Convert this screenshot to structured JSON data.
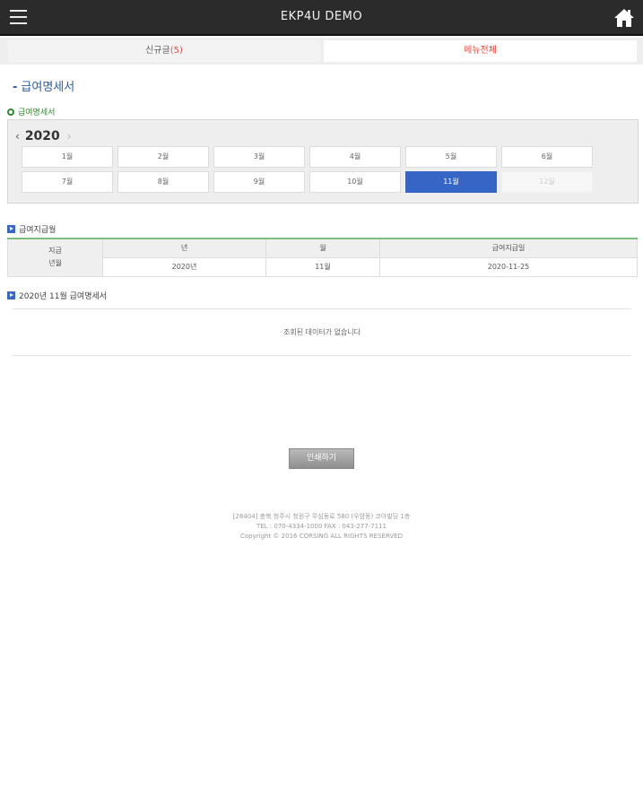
{
  "header": {
    "title": "EKP4U DEMO",
    "menu_icon": "hamburger-icon",
    "home_icon": "home-icon"
  },
  "tabs": {
    "new_label": "신규글",
    "new_count": "(5)",
    "menu_label": "메뉴전체"
  },
  "page": {
    "title": "급여명세서",
    "subtitle": "급여명세서"
  },
  "calendar": {
    "year": "2020",
    "prev": "‹",
    "next": "›",
    "months": [
      "1월",
      "2월",
      "3월",
      "4월",
      "5월",
      "6월",
      "7월",
      "8월",
      "9월",
      "10월",
      "11월",
      "12월"
    ],
    "selected": "11월",
    "disabled": [
      "12월"
    ],
    "active_color": "#3566c6"
  },
  "payment": {
    "label": "급여지급월",
    "row_header_line1": "지급",
    "row_header_line2": "년월",
    "columns": [
      "년",
      "월",
      "급여지급일"
    ],
    "values": [
      "2020년",
      "11월",
      "2020-11-25"
    ]
  },
  "statement": {
    "label": "2020년 11월 급여명세서",
    "empty_text": "조회된 데이터가 없습니다"
  },
  "print_button": "인쇄하기",
  "footer": {
    "address": "[28404] 충북 청주시 청원구 무심동로 580 (우암동) 코아빌딩 1층",
    "tel": "TEL : 070-4334-1000   FAX : 043-277-7111",
    "copyright": "Copyright © 2016 CORSING ALL RIGHTS RESERVED"
  }
}
